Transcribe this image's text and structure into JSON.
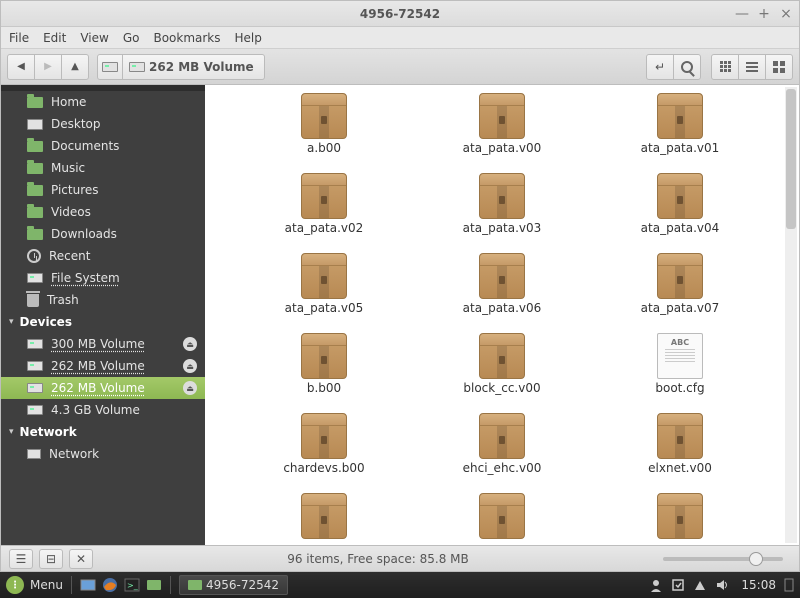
{
  "window": {
    "title": "4956-72542"
  },
  "win_controls": {
    "min": "—",
    "max": "+",
    "close": "×"
  },
  "menu": {
    "file": "File",
    "edit": "Edit",
    "view": "View",
    "go": "Go",
    "bookmarks": "Bookmarks",
    "help": "Help"
  },
  "toolbar": {
    "location_label": "262 MB Volume"
  },
  "sidebar": {
    "places": [
      {
        "label": "Home",
        "icon": "folder"
      },
      {
        "label": "Desktop",
        "icon": "monitor"
      },
      {
        "label": "Documents",
        "icon": "folder"
      },
      {
        "label": "Music",
        "icon": "folder"
      },
      {
        "label": "Pictures",
        "icon": "folder"
      },
      {
        "label": "Videos",
        "icon": "folder"
      },
      {
        "label": "Downloads",
        "icon": "folder"
      },
      {
        "label": "Recent",
        "icon": "recent"
      },
      {
        "label": "File System",
        "icon": "drive",
        "underline": true
      },
      {
        "label": "Trash",
        "icon": "trash"
      }
    ],
    "devices_header": "Devices",
    "devices": [
      {
        "label": "300 MB Volume",
        "eject": true,
        "underline": true
      },
      {
        "label": "262 MB Volume",
        "eject": true,
        "underline": true
      },
      {
        "label": "262 MB Volume",
        "eject": true,
        "underline": true,
        "active": true
      },
      {
        "label": "4.3 GB Volume",
        "eject": false
      }
    ],
    "network_header": "Network",
    "network": [
      {
        "label": "Network"
      }
    ]
  },
  "files": [
    {
      "name": "a.b00",
      "type": "archive"
    },
    {
      "name": "ata_pata.v00",
      "type": "archive"
    },
    {
      "name": "ata_pata.v01",
      "type": "archive"
    },
    {
      "name": "ata_pata.v02",
      "type": "archive"
    },
    {
      "name": "ata_pata.v03",
      "type": "archive"
    },
    {
      "name": "ata_pata.v04",
      "type": "archive"
    },
    {
      "name": "ata_pata.v05",
      "type": "archive"
    },
    {
      "name": "ata_pata.v06",
      "type": "archive"
    },
    {
      "name": "ata_pata.v07",
      "type": "archive"
    },
    {
      "name": "b.b00",
      "type": "archive"
    },
    {
      "name": "block_cc.v00",
      "type": "archive"
    },
    {
      "name": "boot.cfg",
      "type": "text"
    },
    {
      "name": "chardevs.b00",
      "type": "archive"
    },
    {
      "name": "ehci_ehc.v00",
      "type": "archive"
    },
    {
      "name": "elxnet.v00",
      "type": "archive"
    },
    {
      "name": "",
      "type": "archive"
    },
    {
      "name": "",
      "type": "archive"
    },
    {
      "name": "",
      "type": "archive"
    }
  ],
  "status": {
    "text": "96 items, Free space: 85.8 MB"
  },
  "taskbar": {
    "menu_label": "Menu",
    "task_label": "4956-72542",
    "clock": "15:08"
  },
  "textdoc_label": "ABC"
}
